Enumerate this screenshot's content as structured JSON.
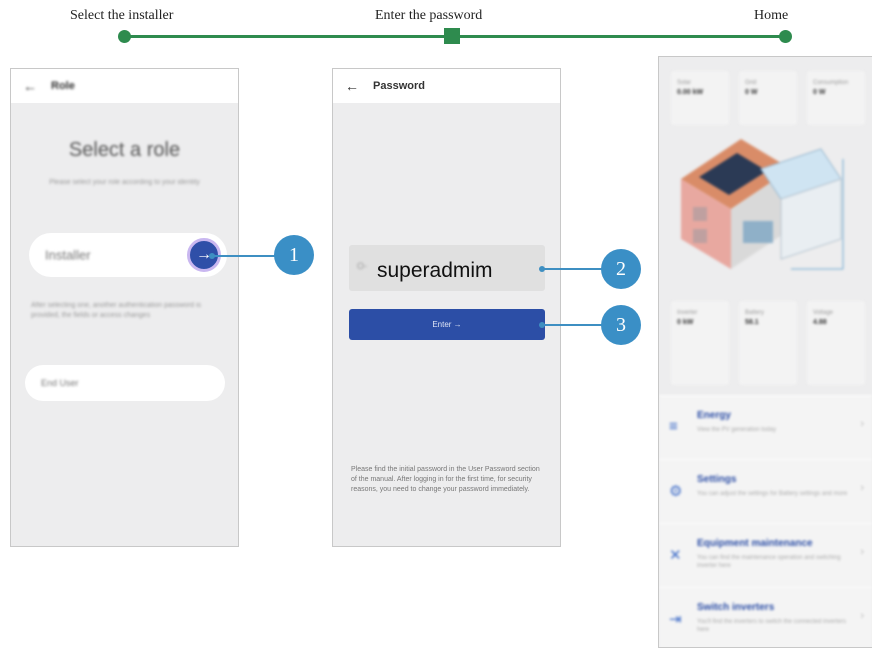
{
  "steps": [
    "Select the installer",
    "Enter the password",
    "Home"
  ],
  "callouts": [
    "1",
    "2",
    "3"
  ],
  "role_screen": {
    "back_icon": "←",
    "header_title": "Role",
    "title": "Select a role",
    "subtitle": "Please select your role according to your identity",
    "installer_label": "Installer",
    "arrow_icon": "→",
    "description": "After selecting one, another authentication password is provided, the fields or access changes",
    "end_user_label": "End User"
  },
  "password_screen": {
    "back_icon": "←",
    "header_title": "Password",
    "eye_icon": "O-",
    "password_value": "superadmim",
    "enter_label": "Enter →",
    "help_text": "Please find the initial password in the User Password section of the manual. After logging in for the first time, for security reasons, you need to change your password immediately."
  },
  "home_screen": {
    "stats_top": [
      {
        "label": "Solar",
        "value": "0.00 kW"
      },
      {
        "label": "Grid",
        "value": "0 W"
      },
      {
        "label": "Consumption",
        "value": "0 W"
      }
    ],
    "stats_bottom": [
      {
        "label": "Inverter",
        "value": "0 kW"
      },
      {
        "label": "Battery",
        "value": "58.1"
      },
      {
        "label": "Voltage",
        "value": "4.88"
      }
    ],
    "menu": [
      {
        "icon": "≡",
        "title": "Energy",
        "desc": "View the PV generation today"
      },
      {
        "icon": "⚙",
        "title": "Settings",
        "desc": "You can adjust the settings for Battery settings and more"
      },
      {
        "icon": "✕",
        "title": "Equipment maintenance",
        "desc": "You can find the maintenance operation and switching inverter here"
      },
      {
        "icon": "⇥",
        "title": "Switch inverters",
        "desc": "You'll find the inverters to switch the connected inverters here"
      }
    ]
  },
  "colors": {
    "progress": "#2e8b4e",
    "callout": "#3a8fc6",
    "primary": "#2c4ea6"
  }
}
